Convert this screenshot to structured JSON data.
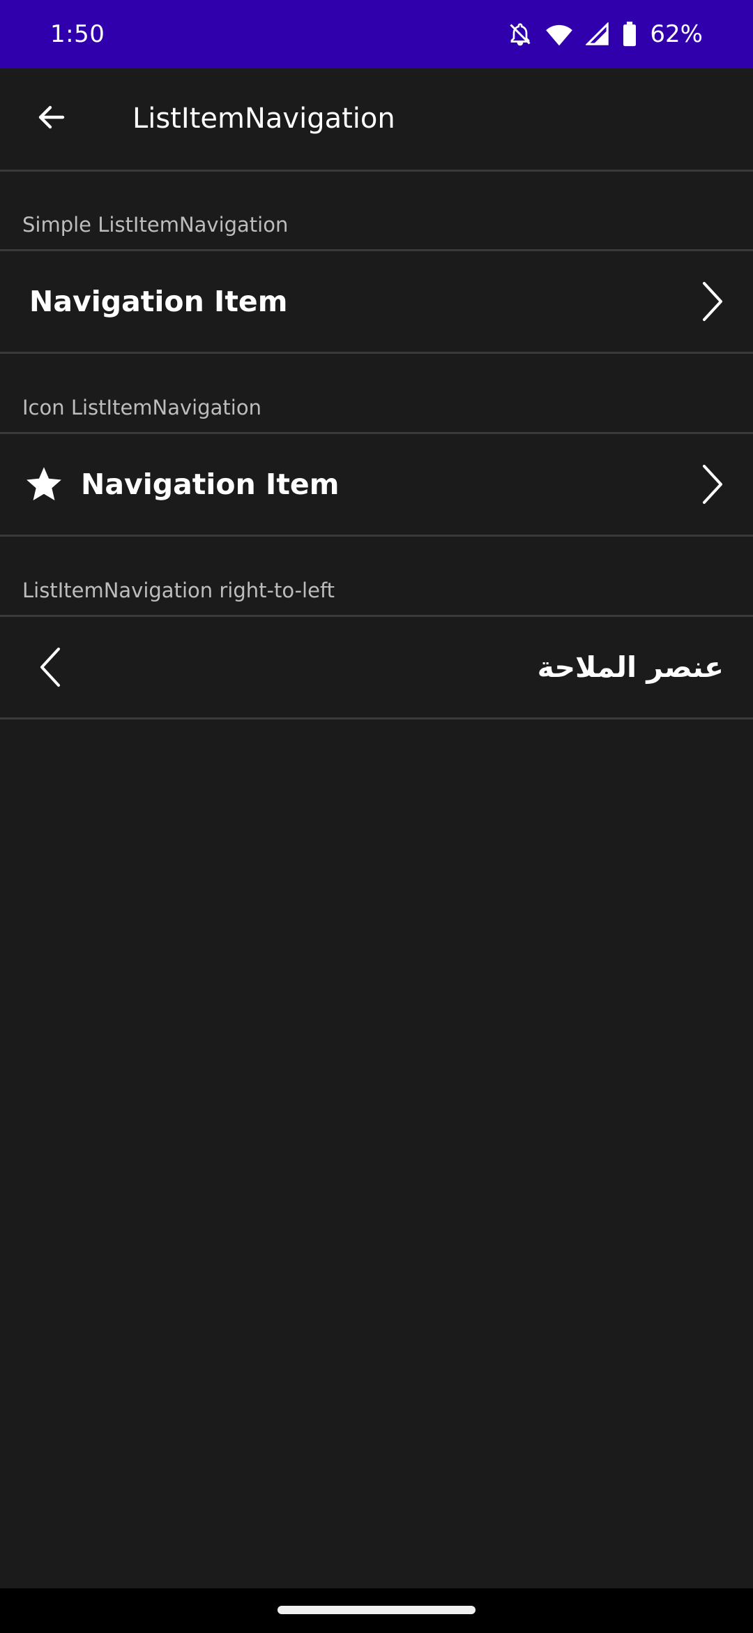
{
  "status_bar": {
    "time": "1:50",
    "battery": "62%",
    "icons": [
      "bell-off-icon",
      "wifi-icon",
      "signal-icon",
      "battery-icon"
    ]
  },
  "app_bar": {
    "title": "ListItemNavigation",
    "back_icon": "arrow-back-icon"
  },
  "sections": [
    {
      "header": "Simple ListItemNavigation",
      "item": {
        "label": "Navigation Item",
        "leading_icon": null,
        "trailing_icon": "chevron-right-icon"
      }
    },
    {
      "header": "Icon ListItemNavigation",
      "item": {
        "label": "Navigation Item",
        "leading_icon": "star-icon",
        "trailing_icon": "chevron-right-icon"
      }
    },
    {
      "header": "ListItemNavigation right-to-left",
      "item": {
        "label": "عنصر الملاحة",
        "leading_icon": null,
        "trailing_icon": "chevron-left-icon"
      }
    }
  ],
  "colors": {
    "status_bar": "#3100ad",
    "background": "#1b1b1b",
    "divider": "#3a3a3a",
    "section_header_text": "#bdbdbd",
    "text": "#ffffff"
  }
}
